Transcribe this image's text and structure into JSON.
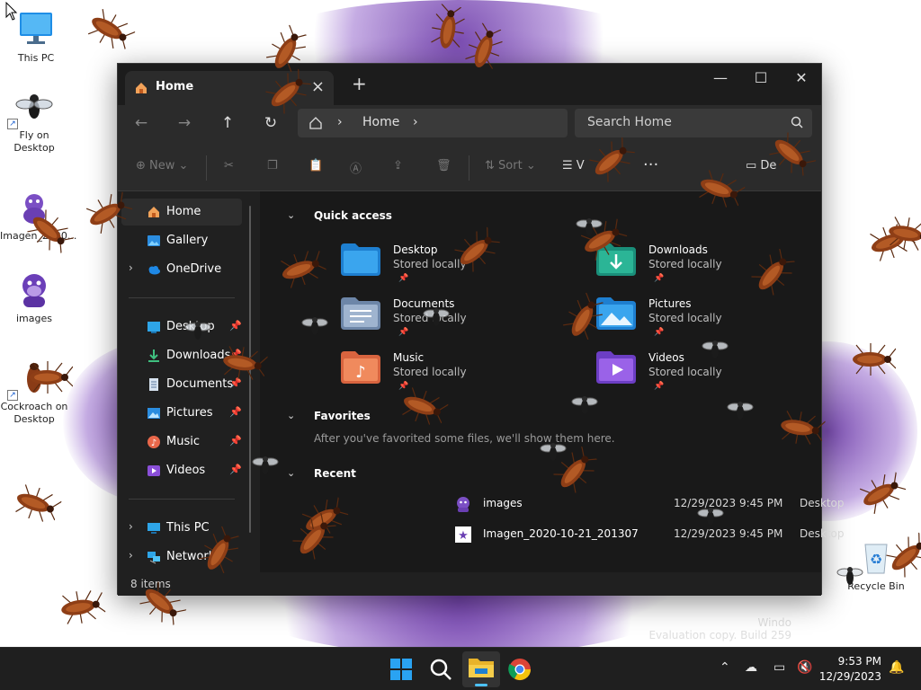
{
  "desktop": {
    "icons": [
      {
        "label": "This PC",
        "icon": "monitor-icon"
      },
      {
        "label": "Fly on Desktop",
        "icon": "fly-icon"
      },
      {
        "label": "Imagen_2020...",
        "icon": "purple-creature-icon"
      },
      {
        "label": "images",
        "icon": "purple-gorilla-icon"
      },
      {
        "label": "Cockroach on Desktop",
        "icon": "cockroach-icon"
      },
      {
        "label": "Recycle Bin",
        "icon": "recycle-bin-icon"
      }
    ],
    "watermark": {
      "line1": "Windo",
      "line2": "Evaluation copy. Build 259"
    }
  },
  "explorer": {
    "tab_title": "Home",
    "address": {
      "segment": "Home"
    },
    "search_placeholder": "Search Home",
    "toolbar": {
      "new_label": "New",
      "sort_label": "Sort",
      "view_label": "V",
      "details_label": "De"
    },
    "sidebar": {
      "top": [
        {
          "label": "Home",
          "icon": "home-icon",
          "selected": true
        },
        {
          "label": "Gallery",
          "icon": "gallery-icon"
        },
        {
          "label": "OneDrive",
          "icon": "cloud-icon"
        }
      ],
      "pinned": [
        {
          "label": "Desktop",
          "icon": "desktop-folder-icon"
        },
        {
          "label": "Downloads",
          "icon": "download-icon"
        },
        {
          "label": "Documents",
          "icon": "documents-icon"
        },
        {
          "label": "Pictures",
          "icon": "pictures-icon"
        },
        {
          "label": "Music",
          "icon": "music-icon"
        },
        {
          "label": "Videos",
          "icon": "videos-icon"
        }
      ],
      "bottom": [
        {
          "label": "This PC",
          "icon": "pc-icon"
        },
        {
          "label": "Network",
          "icon": "network-icon"
        }
      ]
    },
    "sections": {
      "quick_access": "Quick access",
      "favorites": "Favorites",
      "recent": "Recent"
    },
    "quick_access": [
      {
        "name": "Desktop",
        "sub": "Stored locally",
        "icon": "desktop-folder-icon"
      },
      {
        "name": "Downloads",
        "sub": "Stored locally",
        "icon": "downloads-folder-icon"
      },
      {
        "name": "Documents",
        "sub": "Stored locally",
        "icon": "documents-folder-icon"
      },
      {
        "name": "Pictures",
        "sub": "Stored locally",
        "icon": "pictures-folder-icon"
      },
      {
        "name": "Music",
        "sub": "Stored locally",
        "icon": "music-folder-icon"
      },
      {
        "name": "Videos",
        "sub": "Stored locally",
        "icon": "videos-folder-icon"
      }
    ],
    "favorites_empty": "After you've favorited some files, we'll show them here.",
    "recent": [
      {
        "name": "images",
        "date": "12/29/2023 9:45 PM",
        "location": "Desktop"
      },
      {
        "name": "Imagen_2020-10-21_201307",
        "date": "12/29/2023 9:45 PM",
        "location": "Desktop"
      }
    ],
    "status": "8 items"
  },
  "taskbar": {
    "time": "9:53 PM",
    "date": "12/29/2023"
  },
  "colors": {
    "accent": "#0078d4",
    "window_bg": "#202020",
    "wallpaper_purple": "#5a2c8c"
  }
}
